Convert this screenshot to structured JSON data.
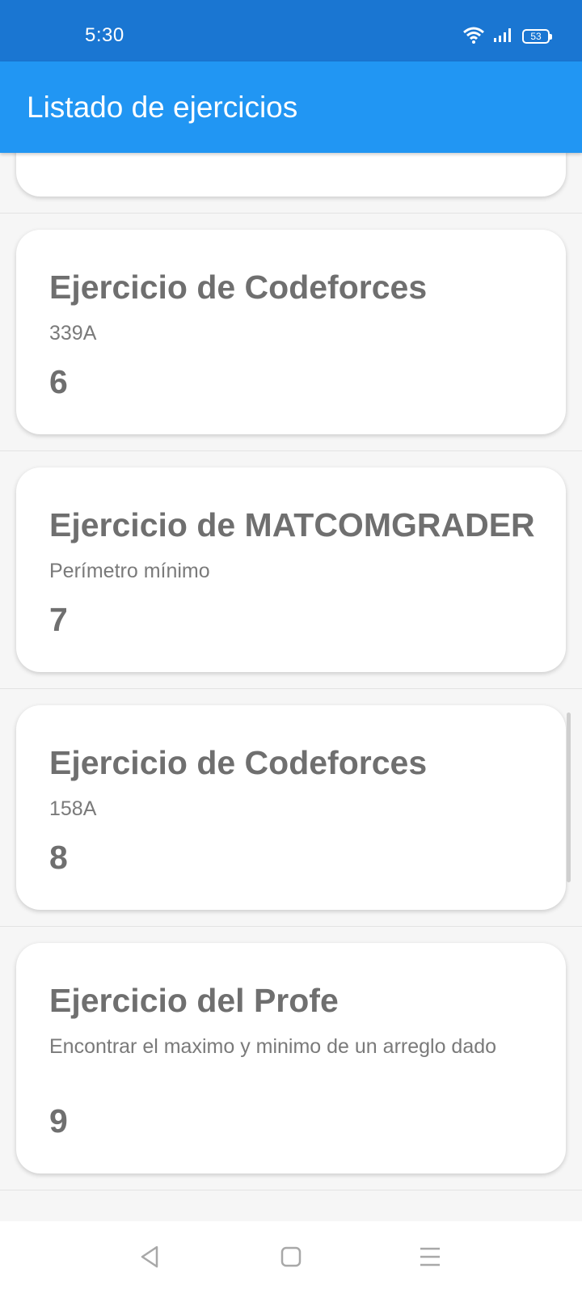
{
  "status_bar": {
    "time": "5:30",
    "battery": "53"
  },
  "app_bar": {
    "title": "Listado de ejercicios"
  },
  "items": [
    {
      "title": "Ejercicio de Codeforces",
      "subtitle": "339A",
      "number": "6"
    },
    {
      "title": "Ejercicio de MATCOMGRADER",
      "subtitle": "Perímetro mínimo",
      "number": "7"
    },
    {
      "title": "Ejercicio de Codeforces",
      "subtitle": "158A",
      "number": "8"
    },
    {
      "title": "Ejercicio del Profe",
      "subtitle": "Encontrar el maximo y minimo de un arreglo dado",
      "number": "9"
    }
  ],
  "icons": {
    "wifi": "wifi-icon",
    "signal": "signal-icon",
    "battery": "battery-icon",
    "nav_back": "back-triangle-icon",
    "nav_home": "home-square-icon",
    "nav_menu": "menu-lines-icon"
  },
  "colors": {
    "status_bar": "#1a76d2",
    "app_bar": "#2196f3",
    "card_text": "#6f6f6f"
  }
}
